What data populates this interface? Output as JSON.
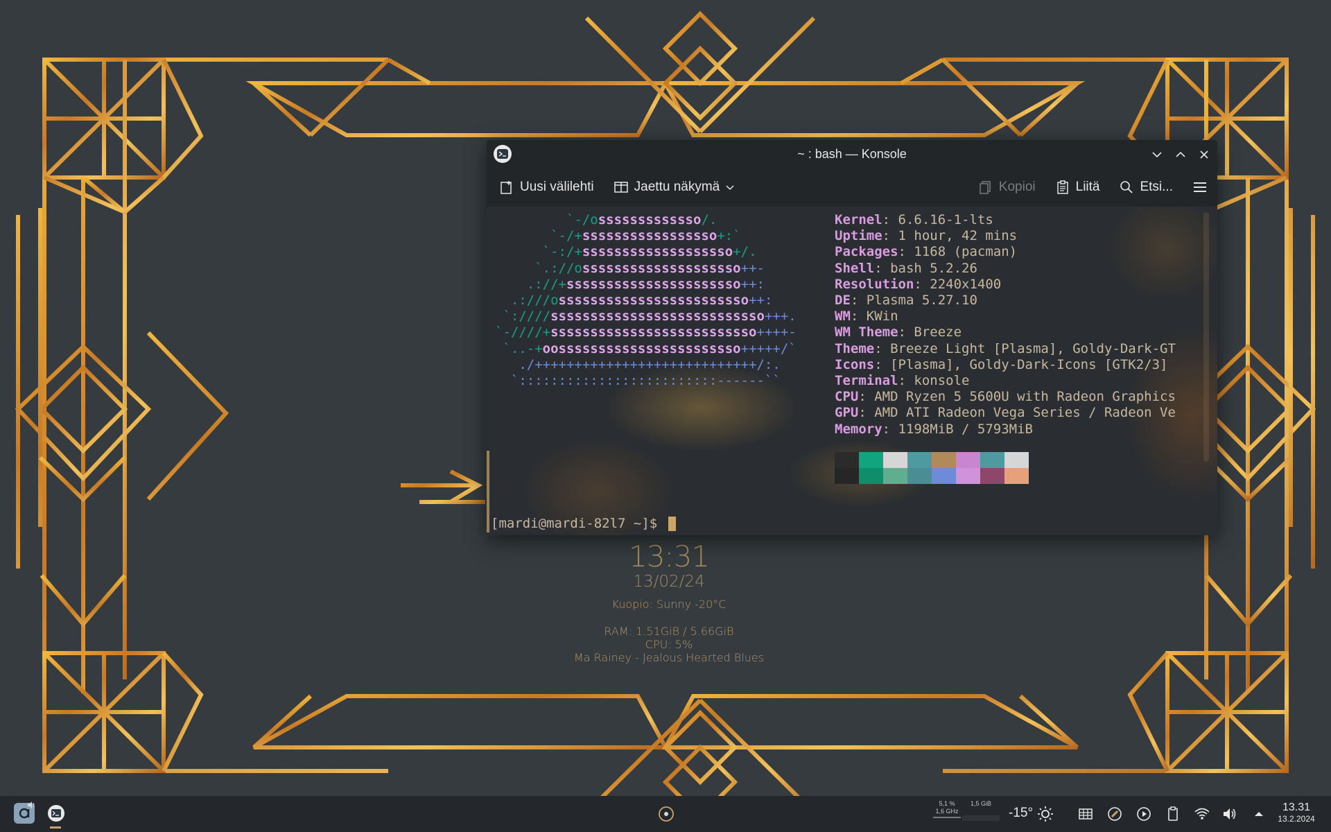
{
  "colors": {
    "gold": "#c9a56a",
    "terminal_green": "#12a285",
    "terminal_pink": "#dfa6eb",
    "terminal_blue": "#6c8bdc"
  },
  "widget": {
    "time": "13:31",
    "date": "13/02/24",
    "weather": "Kuopio: Sunny -20°C",
    "ram": "RAM: 1.51GiB / 5.66GiB",
    "cpu": "CPU: 5%",
    "song": "Ma Rainey - Jealous Hearted Blues"
  },
  "window": {
    "title": "~ : bash — Konsole",
    "icon": "konsole-icon",
    "buttons": [
      "minimize",
      "maximize",
      "close"
    ]
  },
  "toolbar": {
    "new_tab": "Uusi välilehti",
    "split_view": "Jaettu näkymä",
    "copy": "Kopioi",
    "paste": "Liitä",
    "find": "Etsi..."
  },
  "terminal": {
    "ascii_lines": [
      [
        [
          "g",
          "         `-/o"
        ],
        [
          "p",
          "sssssssssssso"
        ],
        [
          "g",
          "/."
        ]
      ],
      [
        [
          "g",
          "       `-/+"
        ],
        [
          "p",
          "sssssssssssssssso"
        ],
        [
          "g",
          "+:`"
        ]
      ],
      [
        [
          "g",
          "      `-:/+"
        ],
        [
          "p",
          "sssssssssssssssssso"
        ],
        [
          "g",
          "+/."
        ]
      ],
      [
        [
          "g",
          "     `.://o"
        ],
        [
          "p",
          "ssssssssssssssssssso"
        ],
        [
          "b",
          "++-"
        ]
      ],
      [
        [
          "g",
          "    .://+"
        ],
        [
          "p",
          "ssssssssssssssssssssso"
        ],
        [
          "b",
          "++:"
        ]
      ],
      [
        [
          "g",
          "  .:///o"
        ],
        [
          "p",
          "ssssssssssssssssssssssso"
        ],
        [
          "b",
          "++:"
        ]
      ],
      [
        [
          "g",
          " `:////"
        ],
        [
          "p",
          "sssssssssssssssssssssssssso"
        ],
        [
          "b",
          "+++."
        ]
      ],
      [
        [
          "g",
          "`-////+"
        ],
        [
          "p",
          "ssssssssssssssssssssssssso"
        ],
        [
          "b",
          "++++-"
        ]
      ],
      [
        [
          "g",
          " `..-+"
        ],
        [
          "p",
          "oosssssssssssssssssssssso"
        ],
        [
          "b",
          "+++++/`"
        ]
      ],
      [
        [
          "b",
          "   ./++++++++++++++++++++++++++++/:."
        ]
      ],
      [
        [
          "b",
          "  `:::::::::::::::::::::::::------``"
        ]
      ]
    ],
    "info": [
      {
        "key": "Kernel",
        "value": "6.6.16-1-lts"
      },
      {
        "key": "Uptime",
        "value": "1 hour, 42 mins"
      },
      {
        "key": "Packages",
        "value": "1168 (pacman)"
      },
      {
        "key": "Shell",
        "value": "bash 5.2.26"
      },
      {
        "key": "Resolution",
        "value": "2240x1400"
      },
      {
        "key": "DE",
        "value": "Plasma 5.27.10"
      },
      {
        "key": "WM",
        "value": "KWin"
      },
      {
        "key": "WM Theme",
        "value": "Breeze"
      },
      {
        "key": "Theme",
        "value": "Breeze Light [Plasma], Goldy-Dark-GT"
      },
      {
        "key": "Icons",
        "value": "[Plasma], Goldy-Dark-Icons [GTK2/3]"
      },
      {
        "key": "Terminal",
        "value": "konsole"
      },
      {
        "key": "CPU",
        "value": "AMD Ryzen 5 5600U with Radeon Graphics"
      },
      {
        "key": "GPU",
        "value": "AMD ATI Radeon Vega Series / Radeon Ve"
      },
      {
        "key": "Memory",
        "value": "1198MiB / 5793MiB"
      }
    ],
    "palette_top": [
      "#2b2b2b",
      "#10a47f",
      "#d6d6d6",
      "#4f9aa0",
      "#b08a5a",
      "#c886cf",
      "#4f9aa0",
      "#d6d6d6"
    ],
    "palette_bottom": [
      "#262626",
      "#0f8e6c",
      "#5fae8f",
      "#4a8d93",
      "#6d8bd6",
      "#d092db",
      "#8e466a",
      "#e7a07a"
    ],
    "prompt": "[mardi@mardi-82l7 ~]$ "
  },
  "taskbar": {
    "cpu_percent": "5,1 %",
    "cpu_freq": "1,6 GHz",
    "mem": "1,5 GiB",
    "temperature": "-15°",
    "clock_time": "13.31",
    "clock_date": "13.2.2024"
  }
}
